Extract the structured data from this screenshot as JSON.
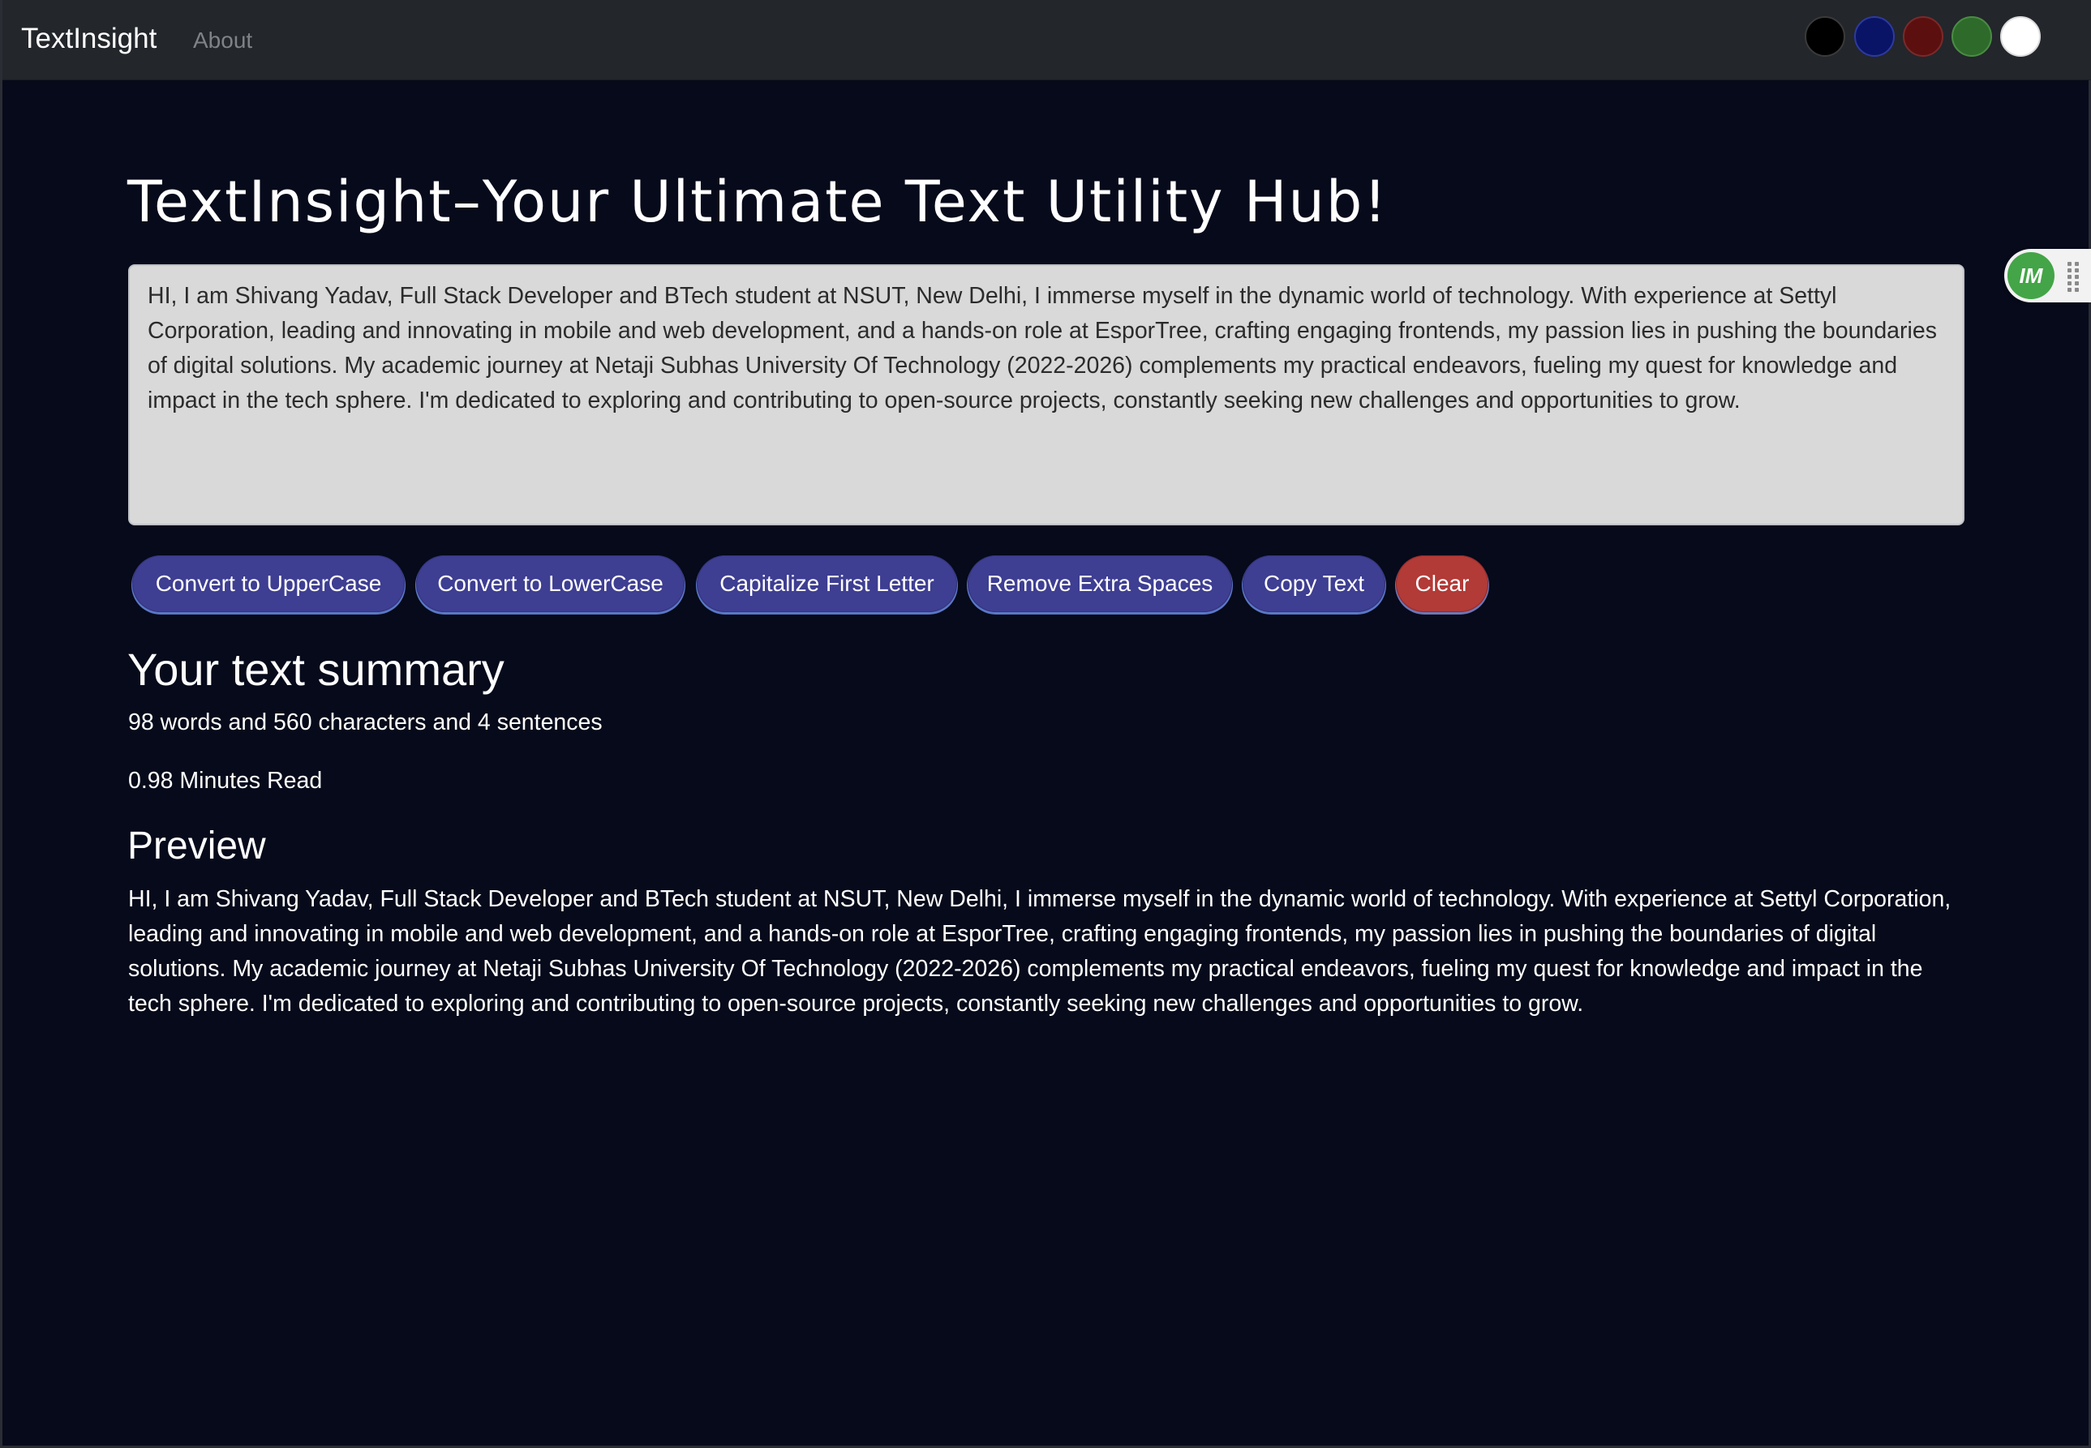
{
  "navbar": {
    "brand": "TextInsight",
    "about_link": "About",
    "theme_swatches": [
      {
        "name": "black",
        "color": "#000000",
        "border": "#3a3a3a"
      },
      {
        "name": "navy",
        "color": "#0a1466",
        "border": "#2c3aa0"
      },
      {
        "name": "maroon",
        "color": "#5c0f0f",
        "border": "#7a2a2a"
      },
      {
        "name": "green",
        "color": "#2e6b2a",
        "border": "#4a8c44"
      },
      {
        "name": "white",
        "color": "#ffffff",
        "border": "#dcdcdc"
      }
    ]
  },
  "main": {
    "title": "TextInsight–Your Ultimate Text Utility Hub!",
    "textarea_value": "HI, I am Shivang Yadav, Full Stack Developer and BTech student at NSUT, New Delhi, I immerse myself in the dynamic world of technology. With experience at Settyl Corporation, leading and innovating in mobile and web development, and a hands-on role at EsporTree, crafting engaging frontends, my passion lies in pushing the boundaries of digital solutions. My academic journey at Netaji Subhas University Of Technology (2022-2026) complements my practical endeavors, fueling my quest for knowledge and impact in the tech sphere. I'm dedicated to exploring and contributing to open-source projects, constantly seeking new challenges and opportunities to grow."
  },
  "buttons": {
    "uppercase": "Convert to UpperCase",
    "lowercase": "Convert to LowerCase",
    "capitalize": "Capitalize First Letter",
    "remove_spaces": "Remove Extra Spaces",
    "copy": "Copy Text",
    "clear": "Clear"
  },
  "summary": {
    "title": "Your text summary",
    "counts": "98 words and 560 characters and 4 sentences",
    "read_time": "0.98 Minutes Read"
  },
  "preview": {
    "title": "Preview",
    "text": "HI, I am Shivang Yadav, Full Stack Developer and BTech student at NSUT, New Delhi, I immerse myself in the dynamic world of technology. With experience at Settyl Corporation, leading and innovating in mobile and web development, and a hands-on role at EsporTree, crafting engaging frontends, my passion lies in pushing the boundaries of digital solutions. My academic journey at Netaji Subhas University Of Technology (2022-2026) complements my practical endeavors, fueling my quest for knowledge and impact in the tech sphere. I'm dedicated to exploring and contributing to open-source projects, constantly seeking new challenges and opportunities to grow."
  },
  "widget": {
    "logo_text": "IM",
    "logo_color": "#43a547"
  },
  "colors": {
    "page_background": "#060a1a",
    "navbar_background": "#23262b",
    "button_primary": "#3e3e92",
    "button_danger": "#b23a37",
    "textarea_background": "#d9d9d9"
  }
}
